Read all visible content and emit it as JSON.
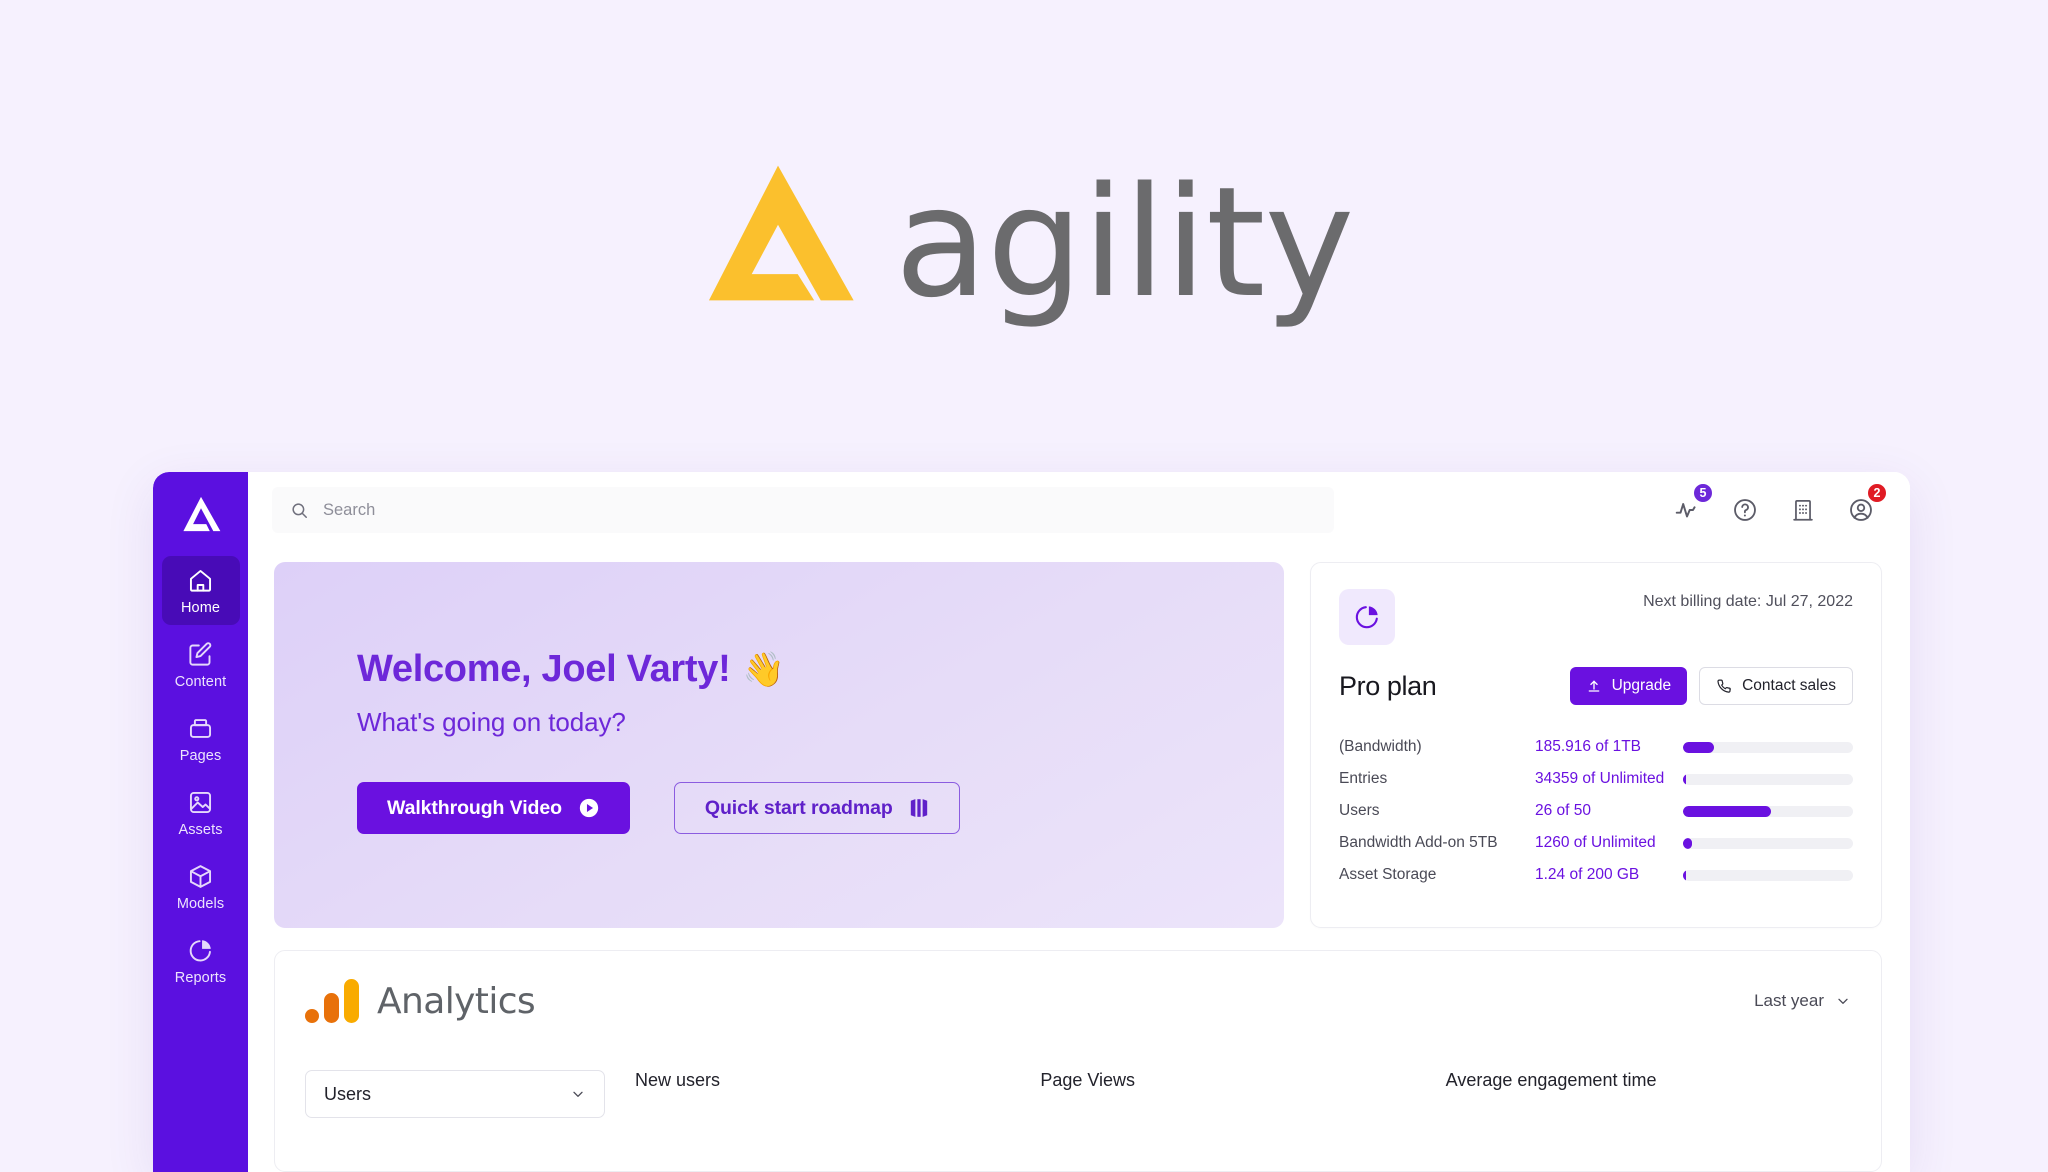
{
  "brand": {
    "wordmark": "agility",
    "logo_color": "#fbc02d",
    "wordmark_color": "#6b6b6d"
  },
  "sidebar": {
    "logo_icon": "agility-triangle-logo",
    "items": [
      {
        "label": "Home",
        "icon": "home-icon",
        "active": true
      },
      {
        "label": "Content",
        "icon": "edit-square-icon",
        "active": false
      },
      {
        "label": "Pages",
        "icon": "pages-icon",
        "active": false
      },
      {
        "label": "Assets",
        "icon": "image-icon",
        "active": false
      },
      {
        "label": "Models",
        "icon": "cube-icon",
        "active": false
      },
      {
        "label": "Reports",
        "icon": "pie-chart-icon",
        "active": false
      }
    ],
    "background": "#5b10e0"
  },
  "topbar": {
    "search": {
      "placeholder": "Search",
      "value": "",
      "icon": "search-icon"
    },
    "icons": [
      {
        "name": "activity-pulse-icon",
        "badge": "5",
        "badge_color": "#6d28d9"
      },
      {
        "name": "help-circle-icon",
        "badge": "",
        "badge_color": ""
      },
      {
        "name": "building-icon",
        "badge": "",
        "badge_color": ""
      },
      {
        "name": "user-avatar-icon",
        "badge": "2",
        "badge_color": "#e01b24"
      }
    ]
  },
  "welcome": {
    "heading": "Welcome, Joel Varty!",
    "wave_emoji": "👋",
    "subheading": "What's going on today?",
    "primary_button": {
      "label": "Walkthrough Video",
      "icon": "play-circle-icon"
    },
    "secondary_button": {
      "label": "Quick start roadmap",
      "icon": "roadmap-bars-icon"
    }
  },
  "plan": {
    "icon": "pie-chart-icon",
    "billing_note": "Next billing date: Jul 27, 2022",
    "title": "Pro plan",
    "upgrade_button": {
      "label": "Upgrade",
      "icon": "upload-icon"
    },
    "contact_button": {
      "label": "Contact sales",
      "icon": "phone-icon"
    },
    "usage": [
      {
        "label": "(Bandwidth)",
        "value": "185.916 of 1TB",
        "percent": 18
      },
      {
        "label": "Entries",
        "value": "34359 of Unlimited",
        "percent": 2
      },
      {
        "label": "Users",
        "value": "26 of 50",
        "percent": 52
      },
      {
        "label": "Bandwidth Add-on 5TB",
        "value": "1260 of Unlimited",
        "percent": 5
      },
      {
        "label": "Asset Storage",
        "value": "1.24 of 200 GB",
        "percent": 2
      }
    ],
    "accent": "#6a11e0"
  },
  "analytics": {
    "title": "Analytics",
    "logo_icon": "google-analytics-icon",
    "range": {
      "label": "Last year",
      "icon": "chevron-down-icon"
    },
    "metric_select": {
      "value": "Users",
      "icon": "chevron-down-icon"
    },
    "metrics": [
      {
        "label": "New users"
      },
      {
        "label": "Page Views"
      },
      {
        "label": "Average engagement time"
      }
    ]
  }
}
